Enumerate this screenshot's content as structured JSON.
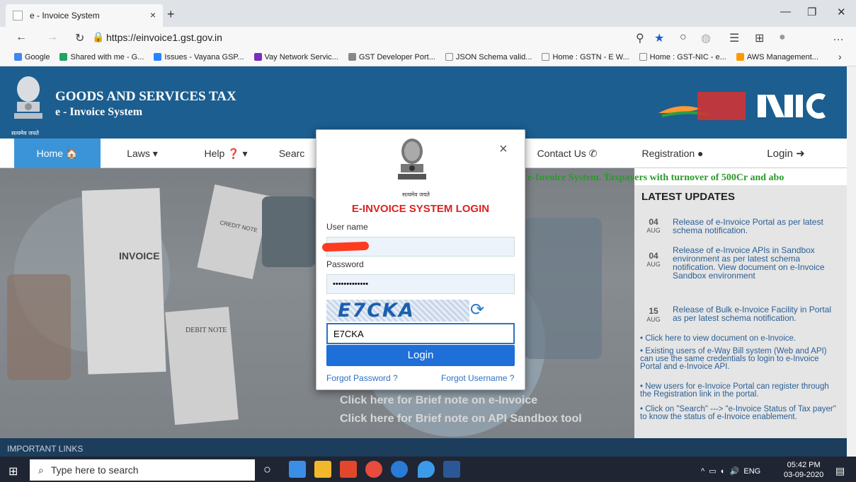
{
  "browser": {
    "tab_title": "e - Invoice System",
    "tab_close": "×",
    "new_tab": "+",
    "url": "https://einvoice1.gst.gov.in",
    "bookmarks": [
      {
        "label": "Google",
        "color": "#4285f4"
      },
      {
        "label": "Shared with me - G...",
        "color": "#1fa463"
      },
      {
        "label": "Issues - Vayana GSP...",
        "color": "#2684ff"
      },
      {
        "label": "Vay Network Servic...",
        "color": "#7b2cbf"
      },
      {
        "label": "GST Developer Port...",
        "color": "#888888"
      },
      {
        "label": "JSON Schema valid...",
        "color": "#bbbbbb"
      },
      {
        "label": "Home : GSTN - E W...",
        "color": "#bbbbbb"
      },
      {
        "label": "Home : GST-NIC - e...",
        "color": "#bbbbbb"
      },
      {
        "label": "AWS Management...",
        "color": "#ff9900"
      }
    ],
    "more": "›"
  },
  "header": {
    "title_line1": "GOODS AND SERVICES TAX",
    "title_line2": "e - Invoice System",
    "emblem_motto": "सत्यमेव जयते"
  },
  "nav": [
    {
      "label": "Home 🏠"
    },
    {
      "label": "Laws ▾"
    },
    {
      "label": "Help ❓ ▾"
    },
    {
      "label": "Searc"
    },
    {
      "label": "Contact Us ✆"
    },
    {
      "label": "Registration ●"
    },
    {
      "label": "Login ➜"
    }
  ],
  "marquee": "e-Invoice System. Taxpayers with turnover of 500Cr and abo",
  "hero": {
    "cta1": "Click here for Brief note on e-Invoice",
    "cta2": "Click here for Brief note on API Sandbox tool",
    "invoice_label": "INVOICE",
    "debit_label": "DEBIT NOTE",
    "credit_label": "CREDIT NOTE"
  },
  "updates": {
    "title": "LATEST UPDATES",
    "items": [
      {
        "day": "04",
        "mon": "AUG",
        "text": "Release of e-Invoice Portal as per latest schema notification."
      },
      {
        "day": "04",
        "mon": "AUG",
        "text": "Release of e-Invoice APIs in Sandbox environment as per latest schema notification. View document on e-Invoice Sandbox environment"
      },
      {
        "day": "15",
        "mon": "AUG",
        "text": "Release of Bulk e-Invoice Facility in Portal as per latest schema notification."
      }
    ],
    "bullets": [
      "Click here to view document on e-Invoice.",
      "Existing users of e-Way Bill system (Web and API) can use the same credentials to login to e-Invoice Portal and e-Invoice API.",
      "New users for e-Invoice Portal can register through the Registration link in the portal.",
      "Click on \"Search\" ---> \"e-Invoice Status of Tax payer\" to know the status of e-Invoice enablement."
    ]
  },
  "important_links": "IMPORTANT LINKS",
  "modal": {
    "title": "E-INVOICE SYSTEM LOGIN",
    "emblem_motto": "सत्यमेव जयते",
    "username_label": "User name",
    "username_value": "",
    "password_label": "Password",
    "password_value": "•••••••••••••",
    "captcha_text": "E7CKA",
    "captcha_input": "E7CKA",
    "login_button": "Login",
    "forgot_password": "Forgot Password ?",
    "forgot_username": "Forgot Username ?",
    "close": "×"
  },
  "taskbar": {
    "search_placeholder": "Type here to search",
    "time": "05:42 PM",
    "date": "03-09-2020",
    "lang": "ENG"
  }
}
